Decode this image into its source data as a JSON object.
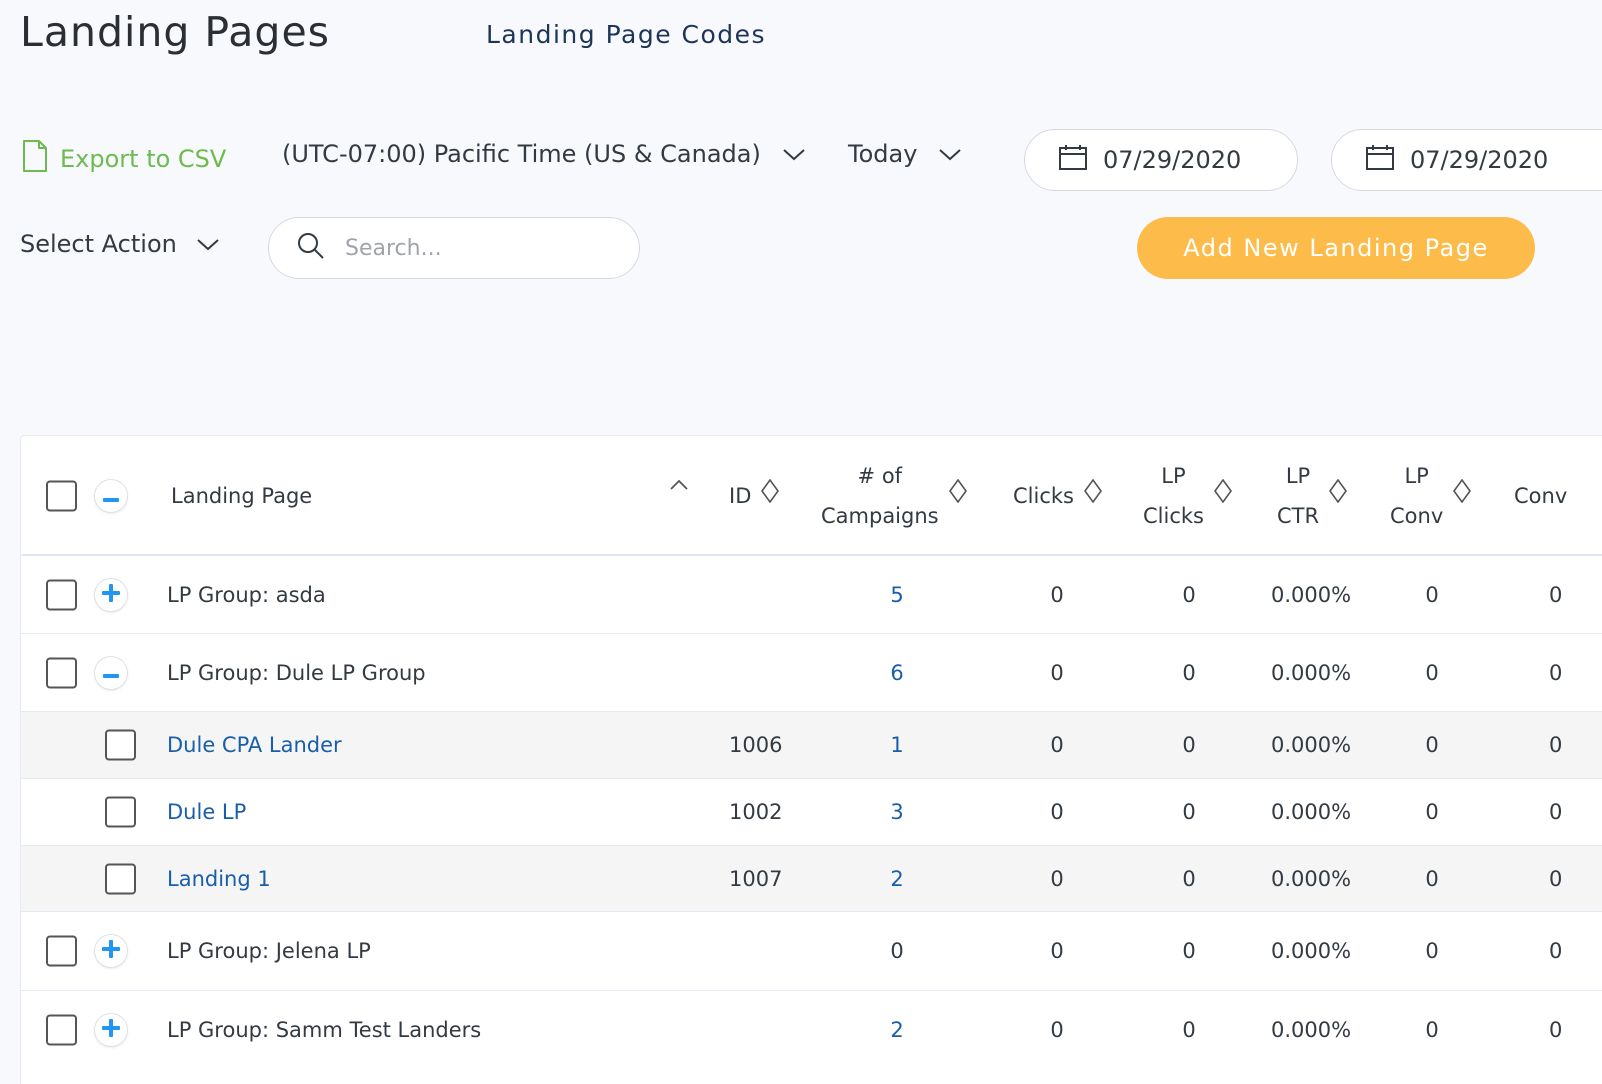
{
  "header": {
    "title": "Landing Pages",
    "codes_link": "Landing Page Codes"
  },
  "toolbar": {
    "export_label": "Export to CSV",
    "timezone": "(UTC-07:00) Pacific Time (US & Canada)",
    "range": "Today",
    "date_from": "07/29/2020",
    "date_to": "07/29/2020",
    "select_action": "Select Action",
    "search_placeholder": "Search...",
    "add_button": "Add New Landing Page"
  },
  "colors": {
    "accent_green": "#6dbb4f",
    "button_orange": "#fdbb4a",
    "link_blue": "#1a5ea8",
    "toggle_blue": "#2196f3"
  },
  "table": {
    "headers": {
      "landing_page": "Landing Page",
      "id": "ID",
      "campaigns_1": "# of",
      "campaigns_2": "Campaigns",
      "clicks": "Clicks",
      "lp_clicks_1": "LP",
      "lp_clicks_2": "Clicks",
      "lp_ctr_1": "LP",
      "lp_ctr_2": "CTR",
      "lp_conv_1": "LP",
      "lp_conv_2": "Conv",
      "conv": "Conv"
    },
    "rows": [
      {
        "name": "LP Group: asda",
        "id": "",
        "campaigns": "5",
        "clicks": "0",
        "lp_clicks": "0",
        "lp_ctr": "0.000%",
        "lp_conv": "0",
        "conv": "0"
      },
      {
        "name": "LP Group: Dule LP Group",
        "id": "",
        "campaigns": "6",
        "clicks": "0",
        "lp_clicks": "0",
        "lp_ctr": "0.000%",
        "lp_conv": "0",
        "conv": "0"
      },
      {
        "name": "Dule CPA Lander",
        "id": "1006",
        "campaigns": "1",
        "clicks": "0",
        "lp_clicks": "0",
        "lp_ctr": "0.000%",
        "lp_conv": "0",
        "conv": "0"
      },
      {
        "name": "Dule LP",
        "id": "1002",
        "campaigns": "3",
        "clicks": "0",
        "lp_clicks": "0",
        "lp_ctr": "0.000%",
        "lp_conv": "0",
        "conv": "0"
      },
      {
        "name": "Landing 1",
        "id": "1007",
        "campaigns": "2",
        "clicks": "0",
        "lp_clicks": "0",
        "lp_ctr": "0.000%",
        "lp_conv": "0",
        "conv": "0"
      },
      {
        "name": "LP Group: Jelena LP",
        "id": "",
        "campaigns": "0",
        "clicks": "0",
        "lp_clicks": "0",
        "lp_ctr": "0.000%",
        "lp_conv": "0",
        "conv": "0"
      },
      {
        "name": "LP Group: Samm Test Landers",
        "id": "",
        "campaigns": "2",
        "clicks": "0",
        "lp_clicks": "0",
        "lp_ctr": "0.000%",
        "lp_conv": "0",
        "conv": "0"
      }
    ]
  }
}
